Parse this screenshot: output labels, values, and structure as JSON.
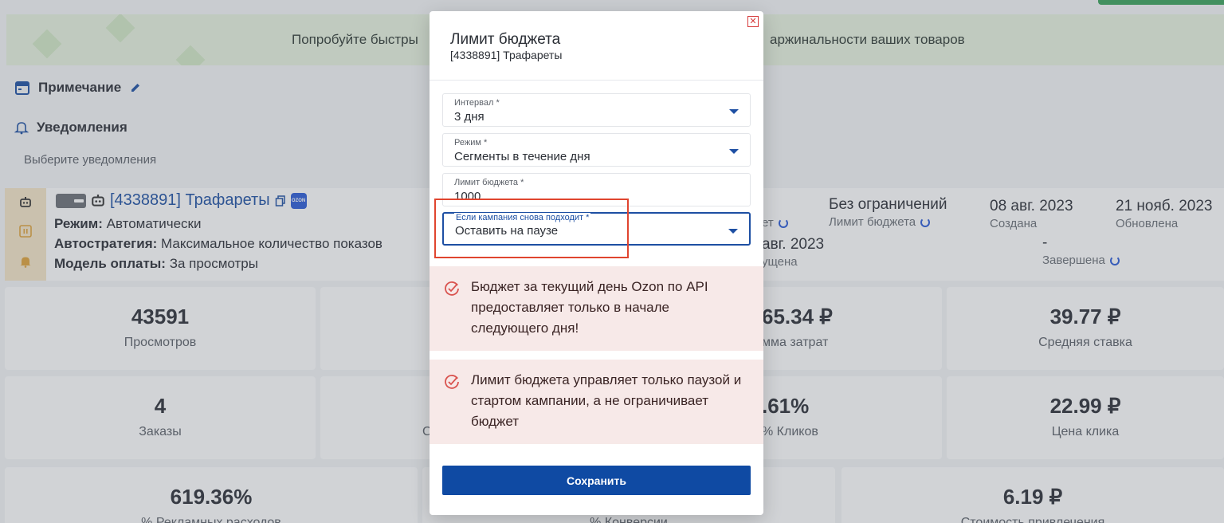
{
  "banner": {
    "text_left": "Попробуйте быстры",
    "text_right": "аржинальности ваших товаров"
  },
  "note": {
    "label": "Примечание"
  },
  "notifications": {
    "label": "Уведомления",
    "placeholder": "Выберите уведомления"
  },
  "campaign": {
    "title": "[4338891] Трафареты",
    "ozon_badge": "OZON",
    "mode_key": "Режим:",
    "mode_val": "Автоматически",
    "strategy_key": "Автостратегия:",
    "strategy_val": "Максимальное количество показов",
    "payment_key": "Модель оплаты:",
    "payment_val": "За просмотры",
    "budget_limit_value": "Без ограничений",
    "budget_limit_label": "Лимит бюджета",
    "partial_label_1": "ет",
    "created_value": "08 авг. 2023",
    "created_label": "Создана",
    "updated_value": "21 нояб. 2023",
    "updated_label": "Обновлена",
    "started_value": "авг. 2023",
    "started_label": "ущена",
    "finished_value": "-",
    "finished_label": "Завершена"
  },
  "tiles": [
    {
      "value": "43591",
      "label": "Просмотров"
    },
    {
      "value": "65.34 ₽",
      "label": "мма затрат"
    },
    {
      "value": "39.77 ₽",
      "label": "Средняя ставка"
    },
    {
      "value": "4",
      "label": "Заказы"
    },
    {
      "value": "С",
      "label": ""
    },
    {
      "value": ".61%",
      "label": "% Кликов"
    },
    {
      "value": "22.99 ₽",
      "label": "Цена клика"
    },
    {
      "value": "619.36%",
      "label": "% Рекламных расходов"
    },
    {
      "value": "",
      "label": "% Конверсии"
    },
    {
      "value": "6.19 ₽",
      "label": "Стоимость привлечения"
    }
  ],
  "modal": {
    "title": "Лимит бюджета",
    "subtitle": "[4338891] Трафареты",
    "fields": {
      "interval": {
        "label": "Интервал *",
        "value": "3 дня"
      },
      "mode": {
        "label": "Режим *",
        "value": "Сегменты в течение дня"
      },
      "limit": {
        "label": "Лимит бюджета *",
        "value": "1000"
      },
      "recover": {
        "label": "Если кампания снова подходит *",
        "value": "Оставить на паузе"
      }
    },
    "alerts": [
      "Бюджет за текущий день Ozon по API предоставляет только в начале следующего дня!",
      "Лимит бюджета управляет только паузой и стартом кампании, а не ограничивает бюджет"
    ],
    "save_label": "Сохранить",
    "close_glyph": "✕"
  },
  "colors": {
    "accent": "#0f4aa3",
    "alert_bg": "#f7e9e8",
    "highlight": "#e0452f"
  }
}
